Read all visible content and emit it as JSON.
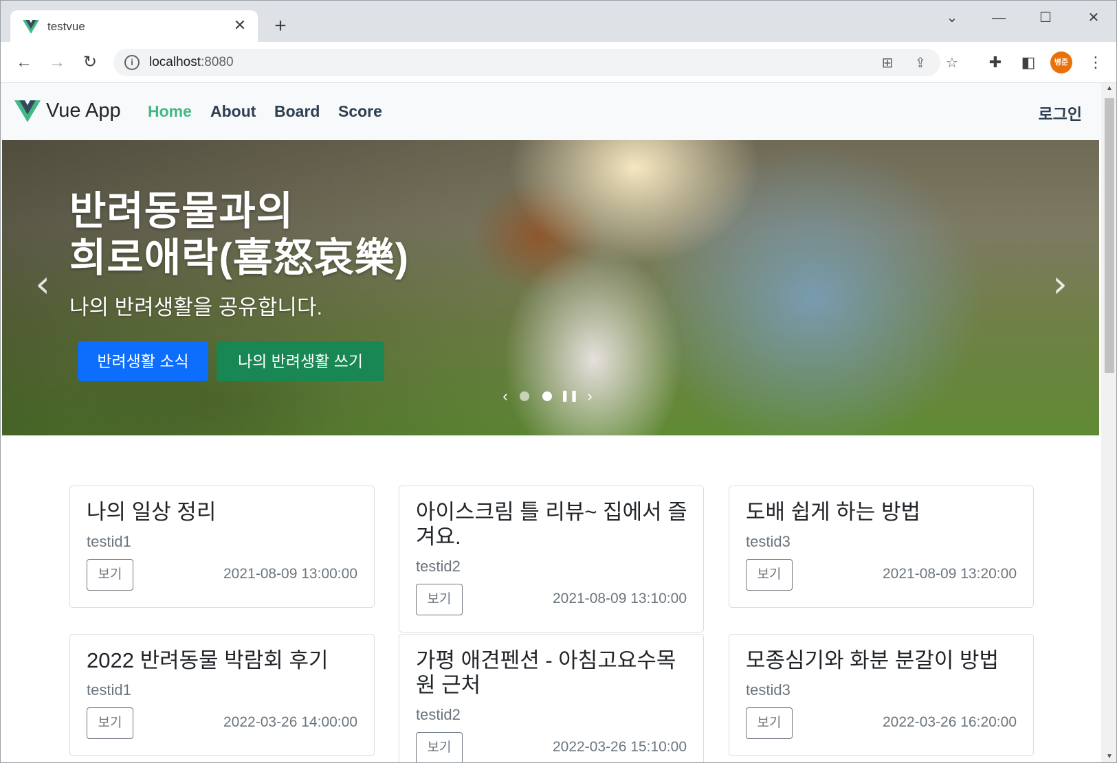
{
  "browser": {
    "tab_title": "testvue",
    "url_host": "localhost",
    "url_port": ":8080",
    "avatar_text": "병준"
  },
  "navbar": {
    "brand": "Vue App",
    "links": [
      "Home",
      "About",
      "Board",
      "Score"
    ],
    "active": "Home",
    "login": "로그인"
  },
  "hero": {
    "title_line1": "반려동물과의",
    "title_line2": "희로애락(喜怒哀樂)",
    "subtitle": "나의 반려생활을 공유합니다.",
    "btn_news": "반려생활 소식",
    "btn_write": "나의 반려생활 쓰기",
    "active_slide": 2,
    "slide_count": 2
  },
  "posts": [
    {
      "title": "나의 일상 정리",
      "author": "testid1",
      "button": "보기",
      "date": "2021-08-09 13:00:00"
    },
    {
      "title": "아이스크림 틀 리뷰~ 집에서 즐겨요.",
      "author": "testid2",
      "button": "보기",
      "date": "2021-08-09 13:10:00"
    },
    {
      "title": "도배 쉽게 하는 방법",
      "author": "testid3",
      "button": "보기",
      "date": "2021-08-09 13:20:00"
    },
    {
      "title": "2022 반려동물 박람회 후기",
      "author": "testid1",
      "button": "보기",
      "date": "2022-03-26 14:00:00"
    },
    {
      "title": "가평 애견펜션 - 아침고요수목원 근처",
      "author": "testid2",
      "button": "보기",
      "date": "2022-03-26 15:10:00"
    },
    {
      "title": "모종심기와 화분 분갈이 방법",
      "author": "testid3",
      "button": "보기",
      "date": "2022-03-26 16:20:00"
    }
  ],
  "colors": {
    "vue_green": "#42b983",
    "nav_text": "#2c3e50",
    "primary": "#0d6efd",
    "success": "#198754"
  }
}
